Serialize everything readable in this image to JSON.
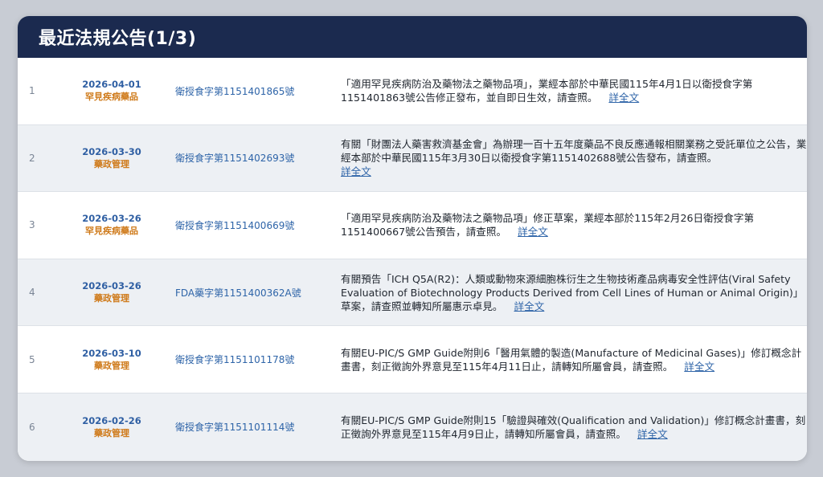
{
  "header": {
    "title": "最近法規公告(1/3)"
  },
  "rows": [
    {
      "num": "1",
      "date": "2026-04-01",
      "category": "罕見疾病藥品",
      "doc_no": "衛授食字第1151401865號",
      "desc": "「適用罕見疾病防治及藥物法之藥物品項」，業經本部於中華民國115年4月1日以衛授食字第1151401863號公告修正發布，並自即日生效，請查照。",
      "more": "詳全文"
    },
    {
      "num": "2",
      "date": "2026-03-30",
      "category": "藥政管理",
      "doc_no": "衛授食字第1151402693號",
      "desc": "有關「財團法人藥害救濟基金會」為辦理一百十五年度藥品不良反應通報相關業務之受託單位之公告，業經本部於中華民國115年3月30日以衛授食字第1151402688號公告發布，請查照。",
      "more": "詳全文"
    },
    {
      "num": "3",
      "date": "2026-03-26",
      "category": "罕見疾病藥品",
      "doc_no": "衛授食字第1151400669號",
      "desc": "「適用罕見疾病防治及藥物法之藥物品項」修正草案，業經本部於115年2月26日衛授食字第1151400667號公告預告，請查照。",
      "more": "詳全文"
    },
    {
      "num": "4",
      "date": "2026-03-26",
      "category": "藥政管理",
      "doc_no": "FDA藥字第1151400362A號",
      "desc": "有關預告「ICH Q5A(R2)：人類或動物來源細胞株衍生之生物技術產品病毒安全性評估(Viral Safety Evaluation of Biotechnology Products Derived from Cell Lines of Human or Animal Origin)」草案，請查照並轉知所屬惠示卓見。",
      "more": "詳全文"
    },
    {
      "num": "5",
      "date": "2026-03-10",
      "category": "藥政管理",
      "doc_no": "衛授食字第1151101178號",
      "desc": "有關EU-PIC/S GMP Guide附則6「醫用氣體的製造(Manufacture of Medicinal Gases)」修訂概念計畫書，刻正徵詢外界意見至115年4月11日止，請轉知所屬會員，請查照。",
      "more": "詳全文"
    },
    {
      "num": "6",
      "date": "2026-02-26",
      "category": "藥政管理",
      "doc_no": "衛授食字第1151101114號",
      "desc": "有關EU-PIC/S GMP Guide附則15「驗證與確效(Qualification and Validation)」修訂概念計畫書，刻正徵詢外界意見至115年4月9日止，請轉知所屬會員，請查照。",
      "more": "詳全文"
    }
  ],
  "colors": {
    "header_bg": "#1b2a4f",
    "date": "#2f5fa3",
    "category": "#cf7a1a",
    "link": "#2e64a8"
  }
}
